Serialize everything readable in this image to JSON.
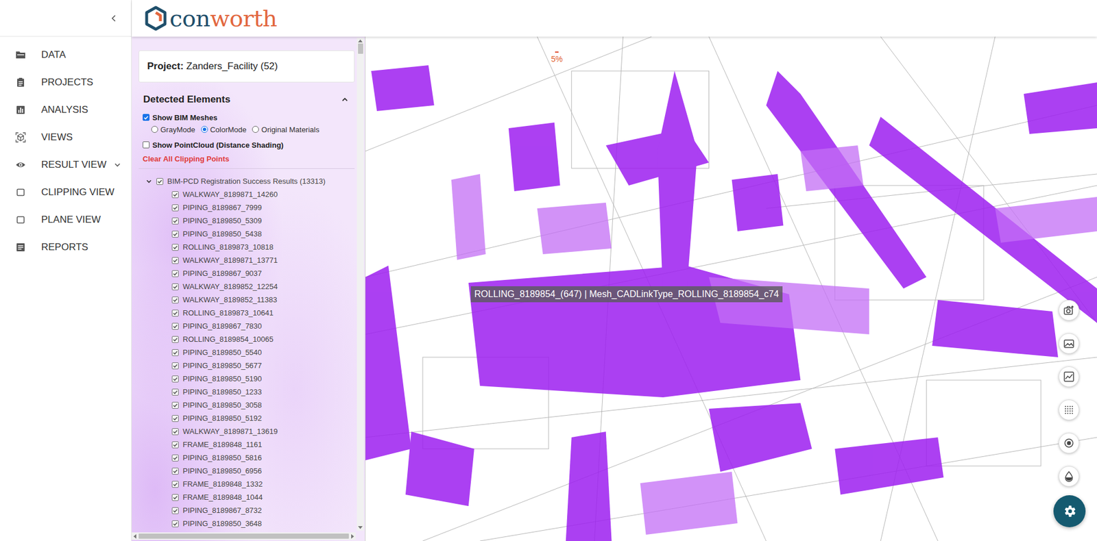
{
  "logo": {
    "left": "con",
    "right": "worth"
  },
  "nav": [
    {
      "label": "DATA",
      "expandable": false,
      "expanded": false
    },
    {
      "label": "PROJECTS",
      "expandable": false,
      "expanded": false
    },
    {
      "label": "ANALYSIS",
      "expandable": false,
      "expanded": false
    },
    {
      "label": "VIEWS",
      "expandable": false,
      "expanded": false
    },
    {
      "label": "RESULT VIEW",
      "expandable": true,
      "expanded": false
    },
    {
      "label": "CLIPPING VIEW",
      "expandable": false,
      "expanded": false
    },
    {
      "label": "PLANE VIEW",
      "expandable": false,
      "expanded": false
    },
    {
      "label": "REPORTS",
      "expandable": false,
      "expanded": false
    }
  ],
  "project": {
    "label": "Project:",
    "name": "Zanders_Facility (52)"
  },
  "detected": {
    "title": "Detected Elements",
    "expanded": true
  },
  "show_bim": {
    "label": "Show BIM Meshes",
    "checked": true
  },
  "modes": [
    {
      "label": "GrayMode",
      "selected": false
    },
    {
      "label": "ColorMode",
      "selected": true
    },
    {
      "label": "Original Materials",
      "selected": false
    }
  ],
  "show_pointcloud": {
    "label": "Show PointCloud (Distance Shading)",
    "checked": false
  },
  "clear_link": "Clear All Clipping Points",
  "tree": {
    "label": "BIM-PCD Registration Success Results (13313)",
    "expanded": true,
    "checked": true,
    "items": [
      {
        "label": "WALKWAY_8189871_14260",
        "checked": true
      },
      {
        "label": "PIPING_8189867_7999",
        "checked": true
      },
      {
        "label": "PIPING_8189850_5309",
        "checked": true
      },
      {
        "label": "PIPING_8189850_5438",
        "checked": true
      },
      {
        "label": "ROLLING_8189873_10818",
        "checked": true
      },
      {
        "label": "WALKWAY_8189871_13771",
        "checked": true
      },
      {
        "label": "PIPING_8189867_9037",
        "checked": true
      },
      {
        "label": "WALKWAY_8189852_12254",
        "checked": true
      },
      {
        "label": "WALKWAY_8189852_11383",
        "checked": true
      },
      {
        "label": "ROLLING_8189873_10641",
        "checked": true
      },
      {
        "label": "PIPING_8189867_7830",
        "checked": true
      },
      {
        "label": "ROLLING_8189854_10065",
        "checked": true
      },
      {
        "label": "PIPING_8189850_5540",
        "checked": true
      },
      {
        "label": "PIPING_8189850_5677",
        "checked": true
      },
      {
        "label": "PIPING_8189850_5190",
        "checked": true
      },
      {
        "label": "PIPING_8189850_1233",
        "checked": true
      },
      {
        "label": "PIPING_8189850_3058",
        "checked": true
      },
      {
        "label": "PIPING_8189850_5192",
        "checked": true
      },
      {
        "label": "WALKWAY_8189871_13619",
        "checked": true
      },
      {
        "label": "FRAME_8189848_1161",
        "checked": true
      },
      {
        "label": "PIPING_8189850_5816",
        "checked": true
      },
      {
        "label": "PIPING_8189850_6956",
        "checked": true
      },
      {
        "label": "FRAME_8189848_1332",
        "checked": true
      },
      {
        "label": "FRAME_8189848_1044",
        "checked": true
      },
      {
        "label": "PIPING_8189867_8732",
        "checked": true
      },
      {
        "label": "PIPING_8189850_3648",
        "checked": true
      }
    ]
  },
  "viewport": {
    "progress": "5%",
    "tooltip": "ROLLING_8189854_(647) | Mesh_CADLinkType_ROLLING_8189854_c74"
  }
}
